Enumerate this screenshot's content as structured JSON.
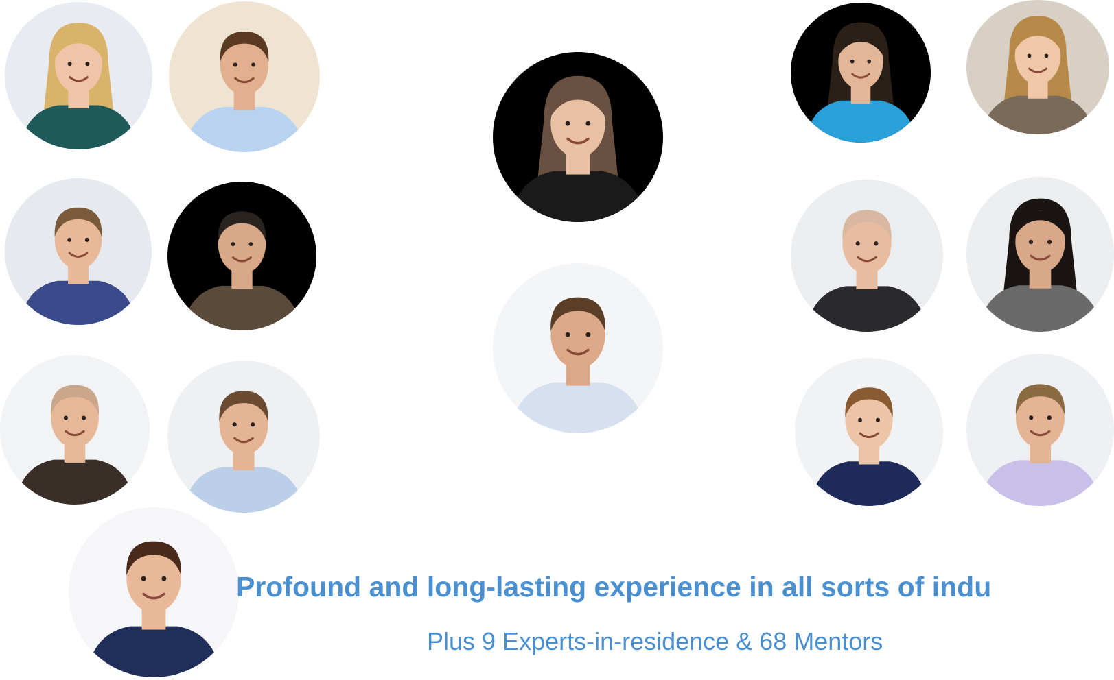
{
  "headline": "Profound and long-lasting experience in all sorts of indu",
  "subline": "Plus 9 Experts-in-residence & 68 Mentors",
  "colors": {
    "text_accent": "#4a90d0",
    "page_background": "#ffffff"
  },
  "portraits": [
    {
      "id": "p1",
      "bg": "#e8ecf2",
      "skin": "#f0c4a8",
      "hair": "#d9b36a",
      "shirt": "#1f5a5a",
      "longHair": true
    },
    {
      "id": "p2",
      "bg": "#efe4d2",
      "skin": "#e2b08e",
      "hair": "#5a3a22",
      "shirt": "#b9d2f0",
      "longHair": false
    },
    {
      "id": "p3",
      "bg": "#e6eaee",
      "skin": "#e8b898",
      "hair": "#7a5a3a",
      "shirt": "#3a4a8a",
      "longHair": false
    },
    {
      "id": "p4",
      "bg": "#000000",
      "skin": "#d8a888",
      "hair": "#2a2420",
      "shirt": "#5a4a3a",
      "longHair": false
    },
    {
      "id": "p5",
      "bg": "#f2f3f5",
      "skin": "#e6b898",
      "hair": "#caa68a",
      "shirt": "#3a2e28",
      "longHair": false
    },
    {
      "id": "p6",
      "bg": "#eef0f2",
      "skin": "#e4b494",
      "hair": "#6a4a30",
      "shirt": "#bccfe8",
      "longHair": false
    },
    {
      "id": "p7",
      "bg": "#f6f6f8",
      "skin": "#e8b898",
      "hair": "#4a2a1a",
      "shirt": "#1f2f5a",
      "longHair": false
    },
    {
      "id": "p8",
      "bg": "#000000",
      "skin": "#e8c0a4",
      "hair": "#6a5040",
      "shirt": "#1a1a1a",
      "longHair": true
    },
    {
      "id": "p9",
      "bg": "#f4f5f7",
      "skin": "#dca888",
      "hair": "#5a3e28",
      "shirt": "#d6e0ee",
      "longHair": false
    },
    {
      "id": "p10",
      "bg": "#000000",
      "skin": "#e4b698",
      "hair": "#2a2018",
      "shirt": "#2aa0d8",
      "longHair": true
    },
    {
      "id": "p11",
      "bg": "#d8d0c4",
      "skin": "#f0c8a8",
      "hair": "#b88a4a",
      "shirt": "#7a6a5a",
      "longHair": true
    },
    {
      "id": "p12",
      "bg": "#eceef0",
      "skin": "#e8bca0",
      "hair": "#d8b8a0",
      "shirt": "#2a2a2e",
      "longHair": false
    },
    {
      "id": "p13",
      "bg": "#eceef0",
      "skin": "#d8a888",
      "hair": "#1a1412",
      "shirt": "#6a6a6a",
      "longHair": true
    },
    {
      "id": "p14",
      "bg": "#f0f2f4",
      "skin": "#ecc4a8",
      "hair": "#8a5a30",
      "shirt": "#1e2a5a",
      "longHair": false
    },
    {
      "id": "p15",
      "bg": "#eef0f4",
      "skin": "#e4b494",
      "hair": "#8a6a40",
      "shirt": "#c8c0e8",
      "longHair": false
    }
  ]
}
